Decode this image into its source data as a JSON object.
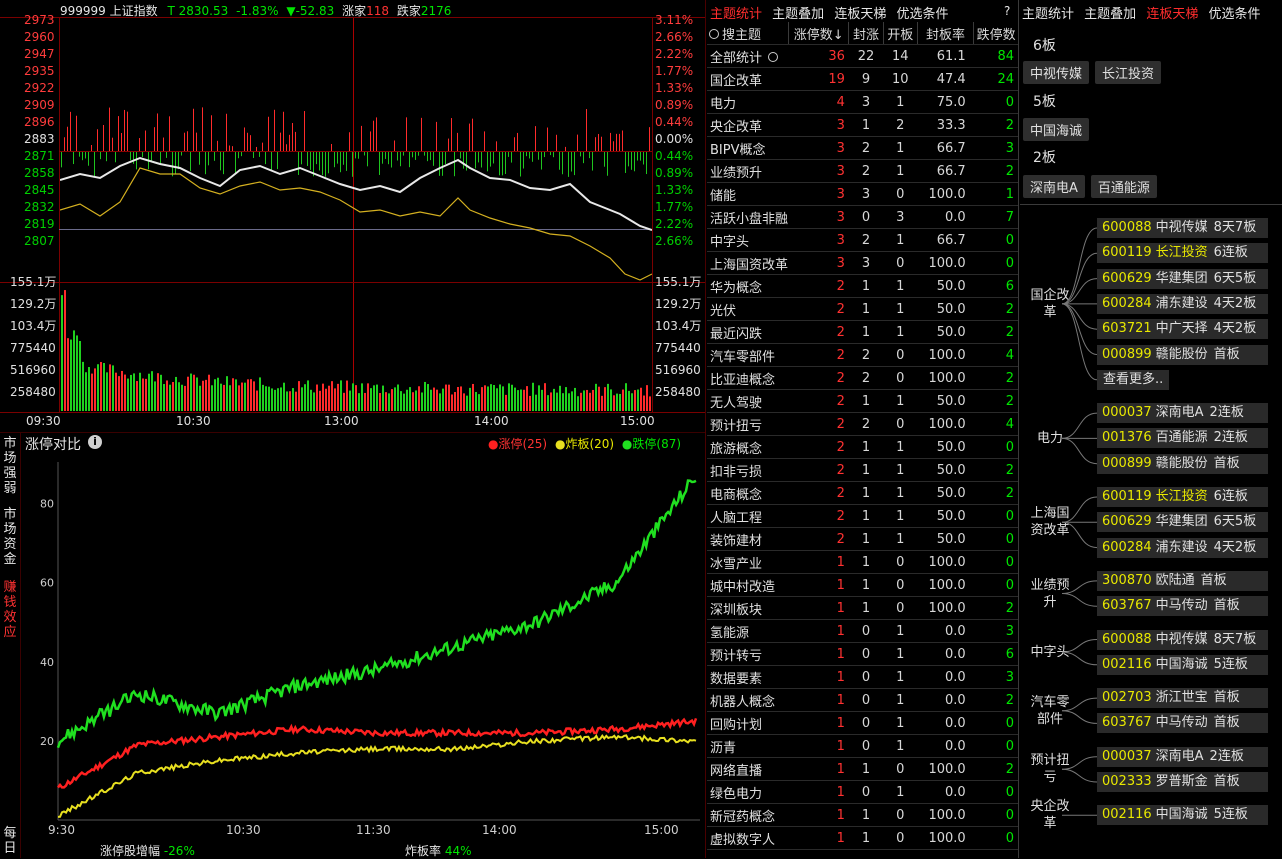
{
  "index_header": {
    "code_name": "999999 上证指数",
    "price": "T 2830.53",
    "change_pct": "-1.83%",
    "change": "▼-52.83",
    "up_label": "涨家",
    "up_count": "118",
    "down_label": "跌家",
    "down_count": "2176"
  },
  "price_axis_left": [
    "2973",
    "2960",
    "2947",
    "2935",
    "2922",
    "2909",
    "2896",
    "2883",
    "2871",
    "2858",
    "2845",
    "2832",
    "2819",
    "2807"
  ],
  "pct_axis_right": [
    "3.11%",
    "2.66%",
    "2.22%",
    "1.77%",
    "1.33%",
    "0.89%",
    "0.44%",
    "0.00%",
    "0.44%",
    "0.89%",
    "1.33%",
    "1.77%",
    "2.22%",
    "2.66%"
  ],
  "vol_axis": [
    "155.1万",
    "129.2万",
    "103.4万",
    "775440",
    "516960",
    "258480"
  ],
  "vol_axis_right": [
    "155.1万",
    "129.2万",
    "103.4万",
    "775440",
    "516960",
    "258480"
  ],
  "time_axis": [
    "09:30",
    "10:30",
    "13:00",
    "14:00",
    "15:00"
  ],
  "side_tabs": [
    "市场强弱",
    "市场资金",
    "赚钱效应",
    "每日"
  ],
  "limit_chart": {
    "title": "涨停对比",
    "info_icon": "info-icon",
    "legend": [
      {
        "label": "涨停(25)",
        "color": "#ff2020"
      },
      {
        "label": "炸板(20)",
        "color": "#e8e020"
      },
      {
        "label": "跌停(87)",
        "color": "#20e020"
      }
    ],
    "y_ticks": [
      "80",
      "60",
      "40",
      "20"
    ],
    "x_ticks": [
      "9:30",
      "10:30",
      "11:30",
      "14:00",
      "15:00"
    ],
    "footer_left_label": "涨停股增幅",
    "footer_left_value": "-26%",
    "footer_right_label": "炸板率",
    "footer_right_value": "44%"
  },
  "chart_data": {
    "type": "line",
    "title": "涨停对比",
    "xlabel": "",
    "ylabel": "",
    "x": [
      "9:30",
      "10:00",
      "10:30",
      "11:00",
      "11:30",
      "13:30",
      "14:00",
      "14:30",
      "15:00"
    ],
    "ylim": [
      0,
      90
    ],
    "series": [
      {
        "name": "涨停(25)",
        "color": "#ff2020",
        "values": [
          8,
          19,
          21,
          23,
          22,
          22,
          22,
          23,
          25
        ]
      },
      {
        "name": "炸板(20)",
        "color": "#e8e020",
        "values": [
          1,
          12,
          15,
          17,
          18,
          18,
          20,
          21,
          20
        ]
      },
      {
        "name": "跌停(87)",
        "color": "#20e020",
        "values": [
          20,
          32,
          27,
          34,
          38,
          44,
          50,
          60,
          87
        ]
      }
    ]
  },
  "topic_panel": {
    "tabs": [
      "主题统计",
      "主题叠加",
      "连板天梯",
      "优选条件"
    ],
    "active_tab": 0,
    "help": "?",
    "search_placeholder": "搜主题",
    "columns": [
      "涨停数↓",
      "封涨",
      "开板",
      "封板率",
      "跌停数"
    ],
    "rows": [
      [
        "全部统计",
        "36",
        "22",
        "14",
        "61.1",
        "84"
      ],
      [
        "国企改革",
        "19",
        "9",
        "10",
        "47.4",
        "24"
      ],
      [
        "电力",
        "4",
        "3",
        "1",
        "75.0",
        "0"
      ],
      [
        "央企改革",
        "3",
        "1",
        "2",
        "33.3",
        "2"
      ],
      [
        "BIPV概念",
        "3",
        "2",
        "1",
        "66.7",
        "3"
      ],
      [
        "业绩预升",
        "3",
        "2",
        "1",
        "66.7",
        "2"
      ],
      [
        "储能",
        "3",
        "3",
        "0",
        "100.0",
        "1"
      ],
      [
        "活跃小盘非融",
        "3",
        "0",
        "3",
        "0.0",
        "7"
      ],
      [
        "中字头",
        "3",
        "2",
        "1",
        "66.7",
        "0"
      ],
      [
        "上海国资改革",
        "3",
        "3",
        "0",
        "100.0",
        "0"
      ],
      [
        "华为概念",
        "2",
        "1",
        "1",
        "50.0",
        "6"
      ],
      [
        "光伏",
        "2",
        "1",
        "1",
        "50.0",
        "2"
      ],
      [
        "最近闪跌",
        "2",
        "1",
        "1",
        "50.0",
        "2"
      ],
      [
        "汽车零部件",
        "2",
        "2",
        "0",
        "100.0",
        "4"
      ],
      [
        "比亚迪概念",
        "2",
        "2",
        "0",
        "100.0",
        "2"
      ],
      [
        "无人驾驶",
        "2",
        "1",
        "1",
        "50.0",
        "2"
      ],
      [
        "预计扭亏",
        "2",
        "2",
        "0",
        "100.0",
        "4"
      ],
      [
        "旅游概念",
        "2",
        "1",
        "1",
        "50.0",
        "0"
      ],
      [
        "扣非亏损",
        "2",
        "1",
        "1",
        "50.0",
        "2"
      ],
      [
        "电商概念",
        "2",
        "1",
        "1",
        "50.0",
        "2"
      ],
      [
        "人脑工程",
        "2",
        "1",
        "1",
        "50.0",
        "0"
      ],
      [
        "装饰建材",
        "2",
        "1",
        "1",
        "50.0",
        "0"
      ],
      [
        "冰雪产业",
        "1",
        "1",
        "0",
        "100.0",
        "0"
      ],
      [
        "城中村改造",
        "1",
        "1",
        "0",
        "100.0",
        "0"
      ],
      [
        "深圳板块",
        "1",
        "1",
        "0",
        "100.0",
        "2"
      ],
      [
        "氢能源",
        "1",
        "0",
        "1",
        "0.0",
        "3"
      ],
      [
        "预计转亏",
        "1",
        "0",
        "1",
        "0.0",
        "6"
      ],
      [
        "数据要素",
        "1",
        "0",
        "1",
        "0.0",
        "3"
      ],
      [
        "机器人概念",
        "1",
        "0",
        "1",
        "0.0",
        "2"
      ],
      [
        "回购计划",
        "1",
        "0",
        "1",
        "0.0",
        "0"
      ],
      [
        "沥青",
        "1",
        "0",
        "1",
        "0.0",
        "0"
      ],
      [
        "网络直播",
        "1",
        "1",
        "0",
        "100.0",
        "2"
      ],
      [
        "绿色电力",
        "1",
        "0",
        "1",
        "0.0",
        "0"
      ],
      [
        "新冠药概念",
        "1",
        "1",
        "0",
        "100.0",
        "0"
      ],
      [
        "虚拟数字人",
        "1",
        "1",
        "0",
        "100.0",
        "0"
      ]
    ]
  },
  "ladder_panel": {
    "tabs": [
      "主题统计",
      "主题叠加",
      "连板天梯",
      "优选条件"
    ],
    "active_tab": 2,
    "boards": [
      {
        "label": "6板",
        "stocks": [
          "中视传媒",
          "长江投资"
        ]
      },
      {
        "label": "5板",
        "stocks": [
          "中国海诚"
        ]
      },
      {
        "label": "2板",
        "stocks": [
          "深南电A",
          "百通能源"
        ]
      }
    ],
    "groups": [
      {
        "label": "国企改革",
        "rows": [
          [
            "600088",
            "中视传媒",
            "8天7板"
          ],
          [
            "600119",
            "长江投资",
            "6连板"
          ],
          [
            "600629",
            "华建集团",
            "6天5板"
          ],
          [
            "600284",
            "浦东建设",
            "4天2板"
          ],
          [
            "603721",
            "中广天择",
            "4天2板"
          ],
          [
            "000899",
            "赣能股份",
            "首板"
          ]
        ],
        "more": "查看更多.."
      },
      {
        "label": "电力",
        "rows": [
          [
            "000037",
            "深南电A",
            "2连板"
          ],
          [
            "001376",
            "百通能源",
            "2连板"
          ],
          [
            "000899",
            "赣能股份",
            "首板"
          ]
        ]
      },
      {
        "label": "上海国资改革",
        "rows": [
          [
            "600119",
            "长江投资",
            "6连板"
          ],
          [
            "600629",
            "华建集团",
            "6天5板"
          ],
          [
            "600284",
            "浦东建设",
            "4天2板"
          ]
        ]
      },
      {
        "label": "业绩预升",
        "rows": [
          [
            "300870",
            "欧陆通",
            "首板"
          ],
          [
            "603767",
            "中马传动",
            "首板"
          ]
        ]
      },
      {
        "label": "中字头",
        "rows": [
          [
            "600088",
            "中视传媒",
            "8天7板"
          ],
          [
            "002116",
            "中国海诚",
            "5连板"
          ]
        ]
      },
      {
        "label": "汽车零部件",
        "rows": [
          [
            "002703",
            "浙江世宝",
            "首板"
          ],
          [
            "603767",
            "中马传动",
            "首板"
          ]
        ]
      },
      {
        "label": "预计扭亏",
        "rows": [
          [
            "000037",
            "深南电A",
            "2连板"
          ],
          [
            "002333",
            "罗普斯金",
            "首板"
          ]
        ]
      },
      {
        "label": "央企改革",
        "rows": [
          [
            "002116",
            "中国海诚",
            "5连板"
          ]
        ]
      }
    ]
  }
}
